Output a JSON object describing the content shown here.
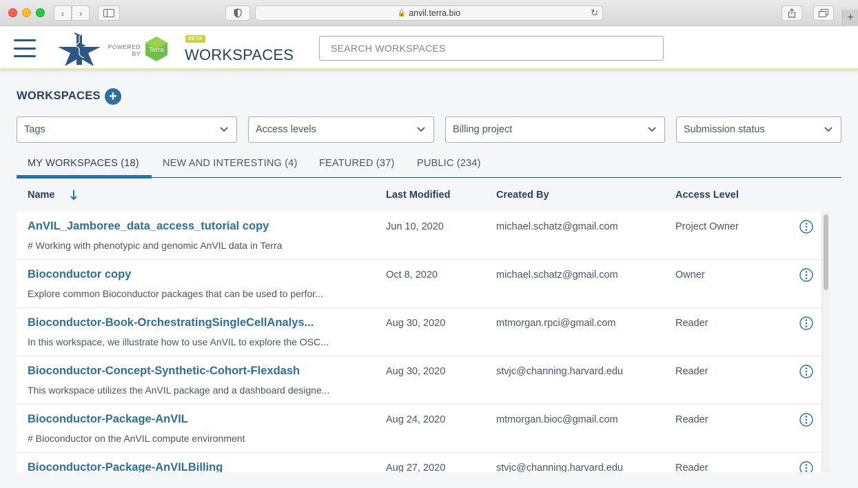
{
  "browser": {
    "url": "anvil.terra.bio",
    "nav_back": "‹",
    "nav_forward": "›",
    "new_tab": "+"
  },
  "header": {
    "powered_by": "POWERED BY",
    "terra_label": "Terra",
    "beta_badge": "BETA",
    "title": "WORKSPACES",
    "search_placeholder": "SEARCH WORKSPACES",
    "accent_color": "#2b6fa3",
    "logo_color": "#2b5885",
    "terra_color": "#6fbf4a"
  },
  "section": {
    "title": "WORKSPACES",
    "add_label": "+"
  },
  "filters": {
    "tags": "Tags",
    "access_levels": "Access levels",
    "billing_project": "Billing project",
    "submission_status": "Submission status"
  },
  "tabs": [
    {
      "label": "MY WORKSPACES (18)",
      "active": true
    },
    {
      "label": "NEW AND INTERESTING (4)",
      "active": false
    },
    {
      "label": "FEATURED (37)",
      "active": false
    },
    {
      "label": "PUBLIC (234)",
      "active": false
    }
  ],
  "columns": {
    "name": "Name",
    "last_modified": "Last Modified",
    "created_by": "Created By",
    "access_level": "Access Level"
  },
  "rows": [
    {
      "name": "AnVIL_Jamboree_data_access_tutorial copy",
      "description": "# Working with phenotypic and genomic AnVIL data in Terra",
      "modified": "Jun 10, 2020",
      "created_by": "michael.schatz@gmail.com",
      "access": "Project Owner"
    },
    {
      "name": "Bioconductor copy",
      "description": "Explore common Bioconductor packages that can be used to perfor...",
      "modified": "Oct 8, 2020",
      "created_by": "michael.schatz@gmail.com",
      "access": "Owner"
    },
    {
      "name": "Bioconductor-Book-OrchestratingSingleCellAnalys...",
      "description": "In this workspace, we illustrate how to use AnVIL to explore the OSC...",
      "modified": "Aug 30, 2020",
      "created_by": "mtmorgan.rpci@gmail.com",
      "access": "Reader"
    },
    {
      "name": "Bioconductor-Concept-Synthetic-Cohort-Flexdash",
      "description": "This workspace utilizes the AnVIL package and a dashboard designe...",
      "modified": "Aug 30, 2020",
      "created_by": "stvjc@channing.harvard.edu",
      "access": "Reader"
    },
    {
      "name": "Bioconductor-Package-AnVIL",
      "description": "# Bioconductor on the AnVIL compute environment",
      "modified": "Aug 24, 2020",
      "created_by": "mtmorgan.bioc@gmail.com",
      "access": "Reader"
    },
    {
      "name": "Bioconductor-Package-AnVILBilling",
      "description": "",
      "modified": "Aug 27, 2020",
      "created_by": "stvjc@channing.harvard.edu",
      "access": "Reader"
    }
  ]
}
